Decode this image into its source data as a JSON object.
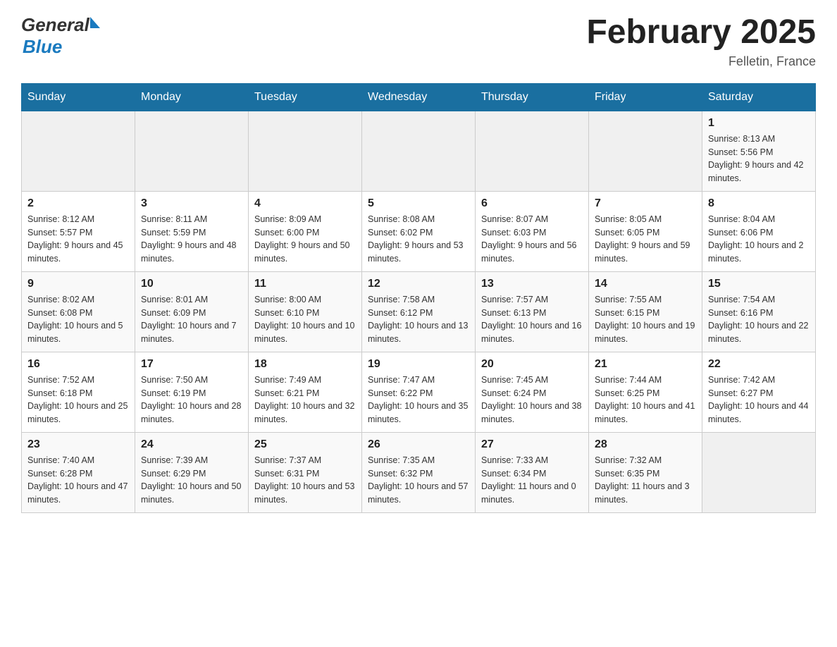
{
  "header": {
    "logo_general": "General",
    "logo_blue": "Blue",
    "month_title": "February 2025",
    "location": "Felletin, France"
  },
  "days_of_week": [
    "Sunday",
    "Monday",
    "Tuesday",
    "Wednesday",
    "Thursday",
    "Friday",
    "Saturday"
  ],
  "weeks": [
    [
      {
        "day": "",
        "info": ""
      },
      {
        "day": "",
        "info": ""
      },
      {
        "day": "",
        "info": ""
      },
      {
        "day": "",
        "info": ""
      },
      {
        "day": "",
        "info": ""
      },
      {
        "day": "",
        "info": ""
      },
      {
        "day": "1",
        "info": "Sunrise: 8:13 AM\nSunset: 5:56 PM\nDaylight: 9 hours and 42 minutes."
      }
    ],
    [
      {
        "day": "2",
        "info": "Sunrise: 8:12 AM\nSunset: 5:57 PM\nDaylight: 9 hours and 45 minutes."
      },
      {
        "day": "3",
        "info": "Sunrise: 8:11 AM\nSunset: 5:59 PM\nDaylight: 9 hours and 48 minutes."
      },
      {
        "day": "4",
        "info": "Sunrise: 8:09 AM\nSunset: 6:00 PM\nDaylight: 9 hours and 50 minutes."
      },
      {
        "day": "5",
        "info": "Sunrise: 8:08 AM\nSunset: 6:02 PM\nDaylight: 9 hours and 53 minutes."
      },
      {
        "day": "6",
        "info": "Sunrise: 8:07 AM\nSunset: 6:03 PM\nDaylight: 9 hours and 56 minutes."
      },
      {
        "day": "7",
        "info": "Sunrise: 8:05 AM\nSunset: 6:05 PM\nDaylight: 9 hours and 59 minutes."
      },
      {
        "day": "8",
        "info": "Sunrise: 8:04 AM\nSunset: 6:06 PM\nDaylight: 10 hours and 2 minutes."
      }
    ],
    [
      {
        "day": "9",
        "info": "Sunrise: 8:02 AM\nSunset: 6:08 PM\nDaylight: 10 hours and 5 minutes."
      },
      {
        "day": "10",
        "info": "Sunrise: 8:01 AM\nSunset: 6:09 PM\nDaylight: 10 hours and 7 minutes."
      },
      {
        "day": "11",
        "info": "Sunrise: 8:00 AM\nSunset: 6:10 PM\nDaylight: 10 hours and 10 minutes."
      },
      {
        "day": "12",
        "info": "Sunrise: 7:58 AM\nSunset: 6:12 PM\nDaylight: 10 hours and 13 minutes."
      },
      {
        "day": "13",
        "info": "Sunrise: 7:57 AM\nSunset: 6:13 PM\nDaylight: 10 hours and 16 minutes."
      },
      {
        "day": "14",
        "info": "Sunrise: 7:55 AM\nSunset: 6:15 PM\nDaylight: 10 hours and 19 minutes."
      },
      {
        "day": "15",
        "info": "Sunrise: 7:54 AM\nSunset: 6:16 PM\nDaylight: 10 hours and 22 minutes."
      }
    ],
    [
      {
        "day": "16",
        "info": "Sunrise: 7:52 AM\nSunset: 6:18 PM\nDaylight: 10 hours and 25 minutes."
      },
      {
        "day": "17",
        "info": "Sunrise: 7:50 AM\nSunset: 6:19 PM\nDaylight: 10 hours and 28 minutes."
      },
      {
        "day": "18",
        "info": "Sunrise: 7:49 AM\nSunset: 6:21 PM\nDaylight: 10 hours and 32 minutes."
      },
      {
        "day": "19",
        "info": "Sunrise: 7:47 AM\nSunset: 6:22 PM\nDaylight: 10 hours and 35 minutes."
      },
      {
        "day": "20",
        "info": "Sunrise: 7:45 AM\nSunset: 6:24 PM\nDaylight: 10 hours and 38 minutes."
      },
      {
        "day": "21",
        "info": "Sunrise: 7:44 AM\nSunset: 6:25 PM\nDaylight: 10 hours and 41 minutes."
      },
      {
        "day": "22",
        "info": "Sunrise: 7:42 AM\nSunset: 6:27 PM\nDaylight: 10 hours and 44 minutes."
      }
    ],
    [
      {
        "day": "23",
        "info": "Sunrise: 7:40 AM\nSunset: 6:28 PM\nDaylight: 10 hours and 47 minutes."
      },
      {
        "day": "24",
        "info": "Sunrise: 7:39 AM\nSunset: 6:29 PM\nDaylight: 10 hours and 50 minutes."
      },
      {
        "day": "25",
        "info": "Sunrise: 7:37 AM\nSunset: 6:31 PM\nDaylight: 10 hours and 53 minutes."
      },
      {
        "day": "26",
        "info": "Sunrise: 7:35 AM\nSunset: 6:32 PM\nDaylight: 10 hours and 57 minutes."
      },
      {
        "day": "27",
        "info": "Sunrise: 7:33 AM\nSunset: 6:34 PM\nDaylight: 11 hours and 0 minutes."
      },
      {
        "day": "28",
        "info": "Sunrise: 7:32 AM\nSunset: 6:35 PM\nDaylight: 11 hours and 3 minutes."
      },
      {
        "day": "",
        "info": ""
      }
    ]
  ]
}
